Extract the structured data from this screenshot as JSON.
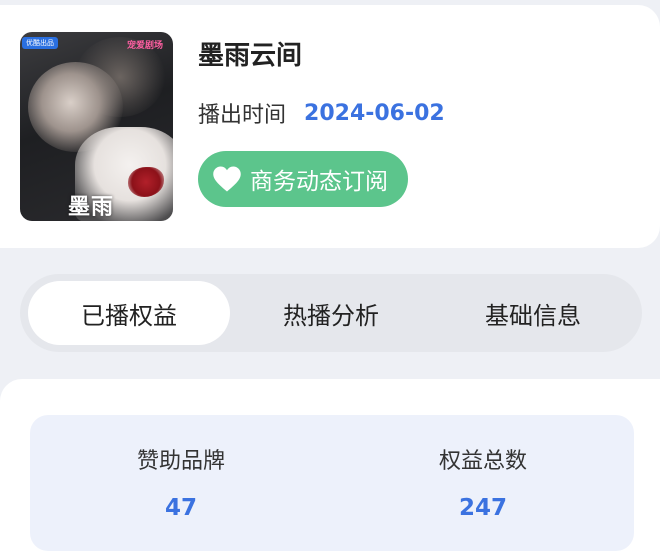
{
  "show": {
    "title": "墨雨云间",
    "air_label": "播出时间",
    "air_date": "2024-06-02",
    "subscribe_label": "商务动态订阅",
    "poster": {
      "badge": "优酷出品",
      "brand": "宠爱剧场",
      "title": "墨雨"
    }
  },
  "tabs": [
    {
      "label": "已播权益",
      "active": true
    },
    {
      "label": "热播分析",
      "active": false
    },
    {
      "label": "基础信息",
      "active": false
    }
  ],
  "stats": [
    {
      "label": "赞助品牌",
      "value": "47"
    },
    {
      "label": "权益总数",
      "value": "247"
    }
  ],
  "colors": {
    "accent_blue": "#3b72e0",
    "subscribe_green": "#5cc58c",
    "page_bg": "#eef0f5",
    "stats_bg": "#edf1fb"
  },
  "icons": {
    "subscribe": "heart-icon"
  }
}
